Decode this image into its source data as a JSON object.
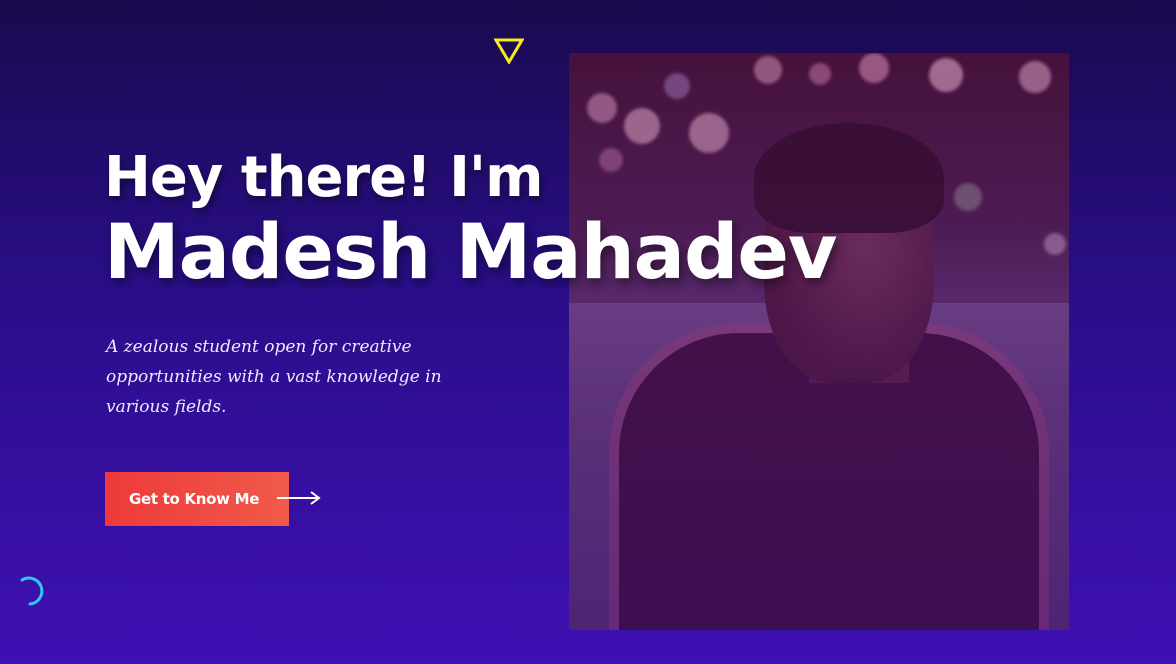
{
  "hero": {
    "greeting": "Hey there! I'm",
    "name": "Madesh Mahadev",
    "tagline": "A zealous student open for creative opportunities with a vast knowledge in various fields.",
    "cta_label": "Get to Know Me"
  },
  "icons": {
    "top": "triangle-icon",
    "cta": "arrow-right-icon",
    "loader": "loader-icon"
  },
  "colors": {
    "background_top": "#1a0a4e",
    "background_bottom": "#3f10b4",
    "accent_yellow": "#f5ec1a",
    "cta_start": "#ee3a3a",
    "cta_end": "#f05a4a",
    "loader": "#2fc8f0"
  }
}
